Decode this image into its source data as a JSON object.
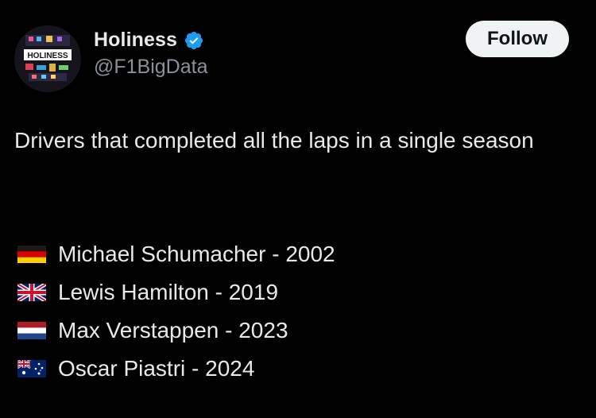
{
  "account": {
    "display_name": "Holiness",
    "handle": "@F1BigData",
    "verified_icon": "verified-badge-icon",
    "avatar_icon": "holiness-logo-avatar",
    "avatar_text": "HOLINESS"
  },
  "actions": {
    "follow_label": "Follow"
  },
  "post": {
    "text": "Drivers that completed all the laps in a single season",
    "drivers": [
      {
        "flag": "germany-flag-icon",
        "label": "Michael Schumacher - 2002"
      },
      {
        "flag": "uk-flag-icon",
        "label": "Lewis Hamilton - 2019"
      },
      {
        "flag": "netherlands-flag-icon",
        "label": "Max Verstappen - 2023"
      },
      {
        "flag": "australia-flag-icon",
        "label": "Oscar Piastri - 2024"
      }
    ]
  },
  "colors": {
    "background": "#000000",
    "primary_text": "#e7e9ea",
    "secondary_text": "#8b9199",
    "follow_bg": "#eff3f4",
    "verified_blue": "#1d9bf0"
  }
}
